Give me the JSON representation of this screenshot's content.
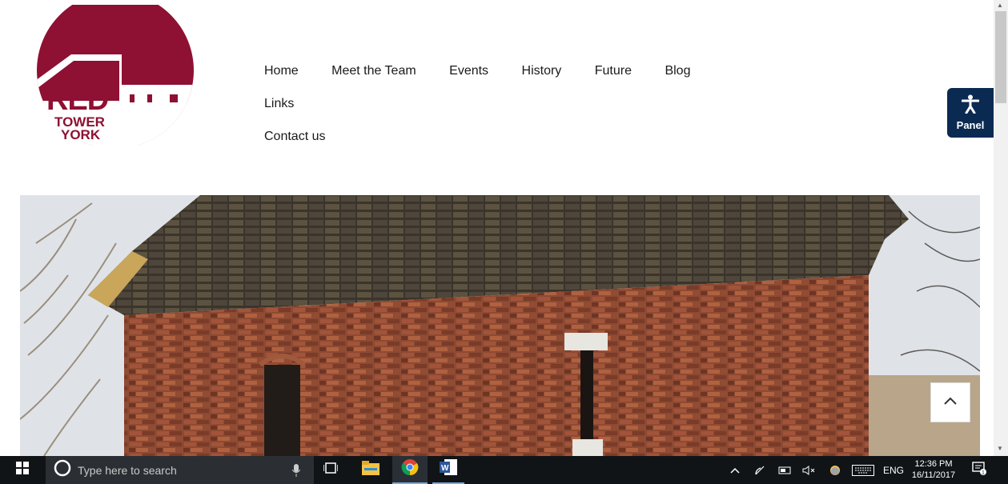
{
  "logo": {
    "line1": "RED",
    "line2": "TOWER",
    "line3": "YORK",
    "color": "#8e1033"
  },
  "nav": {
    "items": [
      "Home",
      "Meet the Team",
      "Events",
      "History",
      "Future",
      "Blog",
      "Links",
      "Contact us"
    ]
  },
  "panel": {
    "label": "Panel",
    "icon": "accessibility-icon",
    "color": "#0b2a52"
  },
  "hero": {
    "description_icon": "photo"
  },
  "back_to_top": {
    "icon": "chevron-up-icon"
  },
  "taskbar": {
    "search_placeholder": "Type here to search",
    "language": "ENG",
    "time": "12:36 PM",
    "date": "16/11/2017"
  }
}
